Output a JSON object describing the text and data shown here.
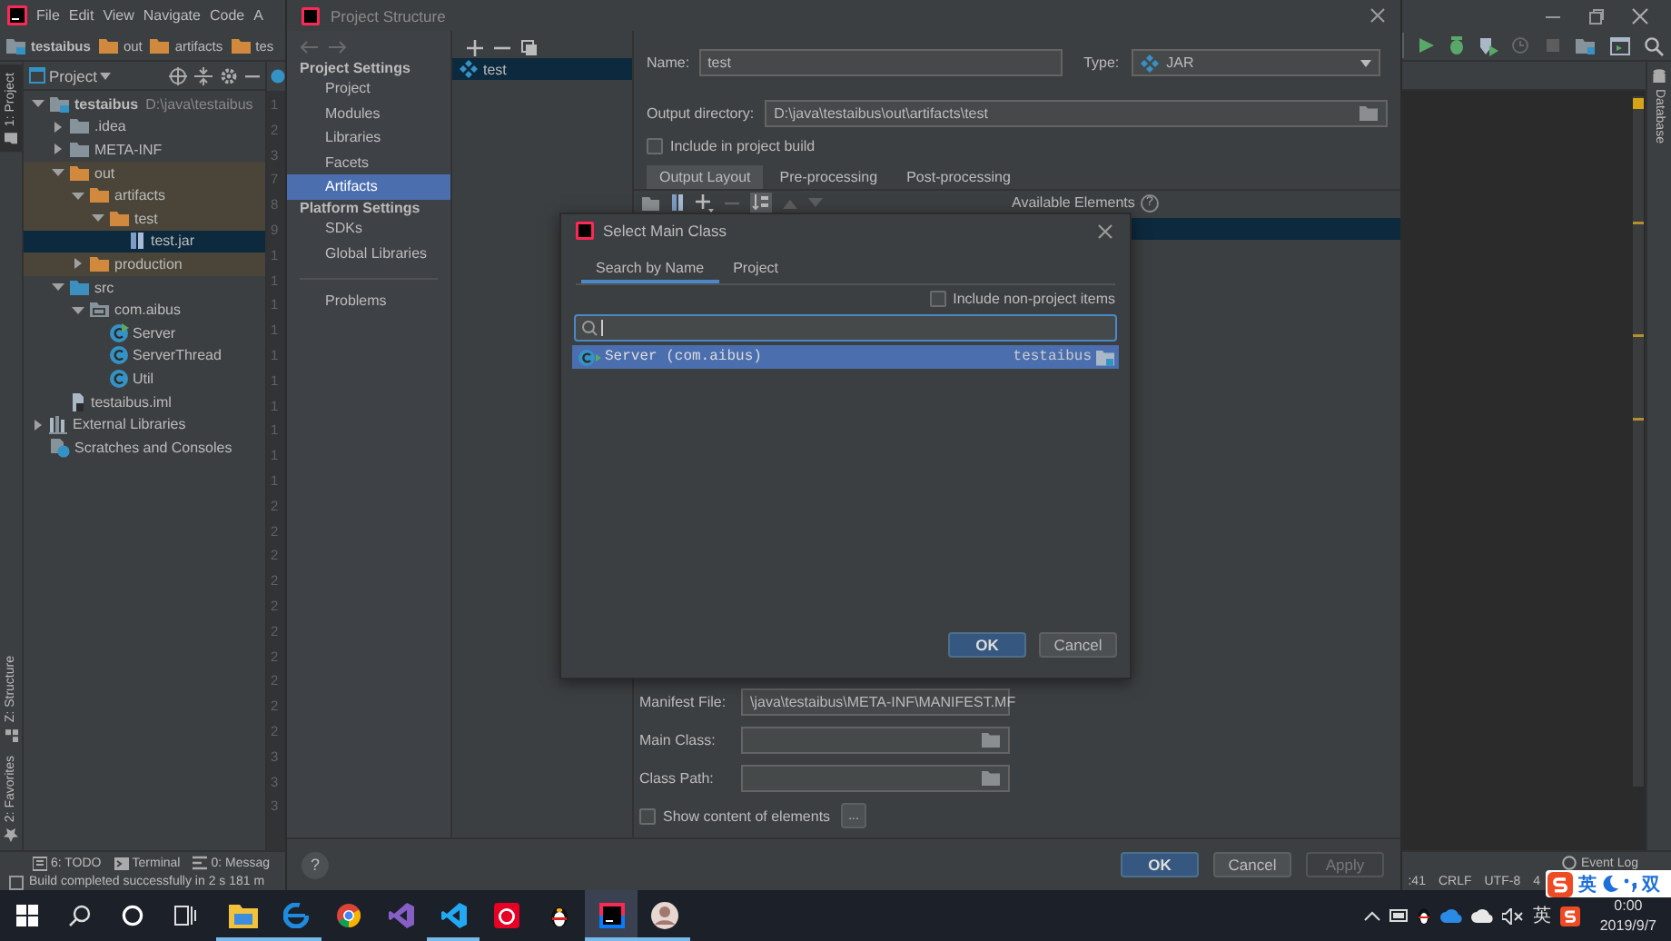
{
  "ide": {
    "menu": [
      "File",
      "Edit",
      "View",
      "Navigate",
      "Code",
      "A"
    ],
    "breadcrumbs": [
      {
        "label": "testaibus",
        "kind": "module"
      },
      {
        "label": "out",
        "kind": "folder"
      },
      {
        "label": "artifacts",
        "kind": "folder"
      },
      {
        "label": "tes",
        "kind": "folder"
      }
    ],
    "left_stripe": [
      {
        "label": "1: Project",
        "kind": "project",
        "selected": true
      },
      {
        "label": "Z: Structure",
        "kind": "structure",
        "selected": false
      },
      {
        "label": "2: Favorites",
        "kind": "favorites",
        "selected": false
      }
    ],
    "project_panel": {
      "title": "Project",
      "tree": [
        {
          "label": "testaibus",
          "note": "D:\\java\\testaibus",
          "kind": "module",
          "expanded": true,
          "excluded": false,
          "selected": false,
          "children": [
            {
              "label": ".idea",
              "kind": "folder",
              "expanded": false,
              "excluded": false,
              "selected": false
            },
            {
              "label": "META-INF",
              "kind": "folder",
              "expanded": false,
              "excluded": false,
              "selected": false
            },
            {
              "label": "out",
              "kind": "folder",
              "expanded": true,
              "excluded": true,
              "selected": false,
              "children": [
                {
                  "label": "artifacts",
                  "kind": "folder",
                  "expanded": true,
                  "excluded": true,
                  "selected": false,
                  "children": [
                    {
                      "label": "test",
                      "kind": "folder",
                      "expanded": true,
                      "excluded": true,
                      "selected": false,
                      "children": [
                        {
                          "label": "test.jar",
                          "kind": "jar",
                          "selected": true
                        }
                      ]
                    }
                  ]
                },
                {
                  "label": "production",
                  "kind": "folder",
                  "expanded": false,
                  "excluded": true,
                  "selected": false
                }
              ]
            },
            {
              "label": "src",
              "kind": "source-folder",
              "expanded": true,
              "excluded": false,
              "selected": false,
              "children": [
                {
                  "label": "com.aibus",
                  "kind": "package",
                  "expanded": true,
                  "excluded": false,
                  "selected": false,
                  "children": [
                    {
                      "label": "Server",
                      "kind": "main-class",
                      "excluded": false,
                      "selected": false
                    },
                    {
                      "label": "ServerThread",
                      "kind": "class",
                      "excluded": false,
                      "selected": false
                    },
                    {
                      "label": "Util",
                      "kind": "class",
                      "excluded": false,
                      "selected": false
                    }
                  ]
                }
              ]
            },
            {
              "label": "testaibus.iml",
              "kind": "module-file",
              "excluded": false,
              "selected": false
            }
          ]
        },
        {
          "label": "External Libraries",
          "kind": "libraries",
          "expanded": false,
          "excluded": false,
          "selected": false
        },
        {
          "label": "Scratches and Consoles",
          "kind": "scratches",
          "excluded": false,
          "selected": false
        }
      ]
    },
    "gutter": [
      "1",
      "2",
      "3",
      "7",
      "8",
      "9",
      "1",
      "1",
      "1",
      "1",
      "1",
      "1",
      "1",
      "1",
      "1",
      "1",
      "2",
      "2",
      "2",
      "2",
      "2",
      "2",
      "2",
      "2",
      "2",
      "2",
      "3",
      "3",
      "3"
    ],
    "right_stripe": [
      "Database"
    ],
    "tool_tabs": [
      {
        "label": "6: TODO",
        "kind": "todo"
      },
      {
        "label": "Terminal",
        "kind": "terminal"
      },
      {
        "label": "0: Messag",
        "kind": "messages"
      }
    ],
    "event_log": "Event Log",
    "status_message": "Build completed successfully in 2 s 181 m",
    "status_items": [
      ":41",
      "CRLF",
      "UTF-8",
      "4"
    ]
  },
  "project_structure": {
    "title": "Project Structure",
    "nav": [
      {
        "title": "Project Settings",
        "items": [
          {
            "label": "Project",
            "selected": false
          },
          {
            "label": "Modules",
            "selected": false
          },
          {
            "label": "Libraries",
            "selected": false
          },
          {
            "label": "Facets",
            "selected": false
          },
          {
            "label": "Artifacts",
            "selected": true
          }
        ]
      },
      {
        "title": "Platform Settings",
        "items": [
          {
            "label": "SDKs",
            "selected": false
          },
          {
            "label": "Global Libraries",
            "selected": false
          }
        ]
      },
      {
        "items": [
          {
            "label": "Problems",
            "selected": false
          }
        ]
      }
    ],
    "artifacts": [
      {
        "label": "test",
        "selected": true
      }
    ],
    "name_label": "Name:",
    "name": "test",
    "type_label": "Type:",
    "type": "JAR",
    "output_label": "Output directory:",
    "output_directory": "D:\\java\\testaibus\\out\\artifacts\\test",
    "include_in_build": {
      "label": "Include in project build",
      "checked": false
    },
    "tabs": [
      {
        "label": "Output Layout",
        "selected": true
      },
      {
        "label": "Pre-processing",
        "selected": false
      },
      {
        "label": "Post-processing",
        "selected": false
      }
    ],
    "available_elements": "Available Elements",
    "available_help": "?",
    "manifest_fields": [
      {
        "label": "Manifest File:",
        "value": "\\java\\testaibus\\META-INF\\MANIFEST.MF",
        "kind": "text"
      },
      {
        "label": "Main Class:",
        "kind": "browse"
      },
      {
        "label": "Class Path:",
        "kind": "browse"
      }
    ],
    "show_content": {
      "label": "Show content of elements",
      "checked": false
    },
    "more_button": "...",
    "help": "?",
    "buttons": [
      {
        "label": "OK",
        "kind": "primary",
        "disabled": false
      },
      {
        "label": "Cancel",
        "kind": "normal",
        "disabled": false
      },
      {
        "label": "Apply",
        "kind": "normal",
        "disabled": true
      }
    ]
  },
  "select_main_class": {
    "title": "Select Main Class",
    "tabs": [
      {
        "label": "Search by Name",
        "selected": true
      },
      {
        "label": "Project",
        "selected": false
      }
    ],
    "include_non_project": {
      "label": "Include non-project items",
      "checked": false
    },
    "results": [
      {
        "name": "Server (com.aibus)",
        "module": "testaibus",
        "selected": true
      }
    ],
    "buttons": [
      {
        "label": "OK",
        "kind": "primary"
      },
      {
        "label": "Cancel",
        "kind": "normal"
      }
    ]
  },
  "taskbar": {
    "apps": [
      {
        "kind": "files",
        "running": true,
        "active": false
      },
      {
        "kind": "edge",
        "running": true,
        "active": false
      },
      {
        "kind": "chrome",
        "running": false,
        "active": false
      },
      {
        "kind": "vs",
        "running": false,
        "active": false
      },
      {
        "kind": "vscode",
        "running": true,
        "active": false
      },
      {
        "kind": "music",
        "running": false,
        "active": false
      },
      {
        "kind": "qq",
        "running": false,
        "active": false
      },
      {
        "kind": "jetbrains",
        "running": true,
        "active": true
      },
      {
        "kind": "avatar",
        "running": true,
        "active": false
      }
    ],
    "language": "英",
    "time": "0:00",
    "date": "2019/9/7"
  },
  "ime": {
    "mode": "英",
    "width": "双"
  }
}
